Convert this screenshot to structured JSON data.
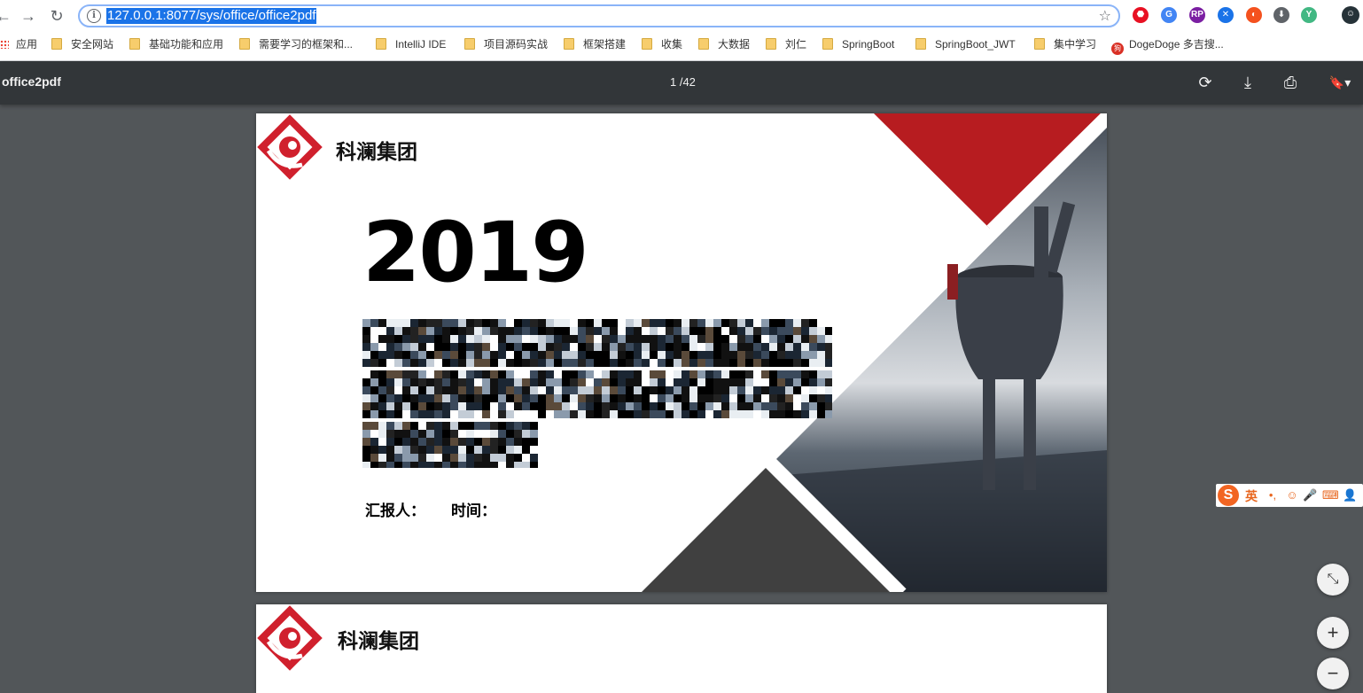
{
  "browser": {
    "back_icon": "arrow-left-icon",
    "forward_icon": "arrow-right-icon",
    "reload_icon": "reload-icon",
    "url": "127.0.0.1:8077/sys/office/office2pdf",
    "nav": {
      "back": "←",
      "forward": "→",
      "reload": "↻",
      "info": "i",
      "star": "☆"
    },
    "extensions": [
      {
        "name": "adblock-icon",
        "color": "#e81123",
        "glyph": "⬣"
      },
      {
        "name": "translate-icon",
        "color": "#4285f4",
        "glyph": "G"
      },
      {
        "name": "rp-icon",
        "color": "#7b1fa2",
        "glyph": "RP"
      },
      {
        "name": "extension-blue-icon",
        "color": "#1a73e8",
        "glyph": "✕"
      },
      {
        "name": "extension-orange-icon",
        "color": "#f4511e",
        "glyph": "◐"
      },
      {
        "name": "download-icon",
        "color": "#5f6368",
        "glyph": "⬇"
      },
      {
        "name": "vue-icon",
        "color": "#42b883",
        "glyph": "Y"
      },
      {
        "name": "profile-avatar-icon",
        "color": "#263238",
        "glyph": "☺"
      }
    ]
  },
  "bookmarks": [
    {
      "label": "应用",
      "type": "apps"
    },
    {
      "label": "安全网站",
      "type": "folder"
    },
    {
      "label": "基础功能和应用",
      "type": "folder"
    },
    {
      "label": "需要学习的框架和...",
      "type": "folder"
    },
    {
      "label": "IntelliJ IDE",
      "type": "folder"
    },
    {
      "label": "项目源码实战",
      "type": "folder"
    },
    {
      "label": "框架搭建",
      "type": "folder"
    },
    {
      "label": "收集",
      "type": "folder"
    },
    {
      "label": "大数据",
      "type": "folder"
    },
    {
      "label": "刘仁",
      "type": "folder"
    },
    {
      "label": "SpringBoot",
      "type": "folder"
    },
    {
      "label": "SpringBoot_JWT",
      "type": "folder"
    },
    {
      "label": "集中学习",
      "type": "folder"
    },
    {
      "label": "DogeDoge 多吉搜...",
      "type": "site"
    }
  ],
  "pdf_viewer": {
    "title": "office2pdf",
    "page_indicator": "1 /42",
    "rotate_icon": "rotate-icon",
    "download_icon": "download-icon",
    "print_icon": "print-icon",
    "bookmark_icon": "bookmark-icon",
    "buttons": {
      "rotate": "⟳",
      "download": "⤓",
      "print": "⎙",
      "bookmark": "🔖▾"
    }
  },
  "slide1": {
    "company": "科澜集团",
    "year": "2019",
    "reporter_label": "汇报人：",
    "time_label": "时间：",
    "colors": {
      "red": "#b71c20",
      "dark": "#404040"
    }
  },
  "slide2": {
    "company": "科澜集团"
  },
  "ime": {
    "logo": "S",
    "lang": "英",
    "icons": [
      "•,",
      "☺",
      "🎤",
      "⌨",
      "👤"
    ]
  },
  "zoom": {
    "fit": "⤡",
    "in": "+",
    "out": "−"
  }
}
